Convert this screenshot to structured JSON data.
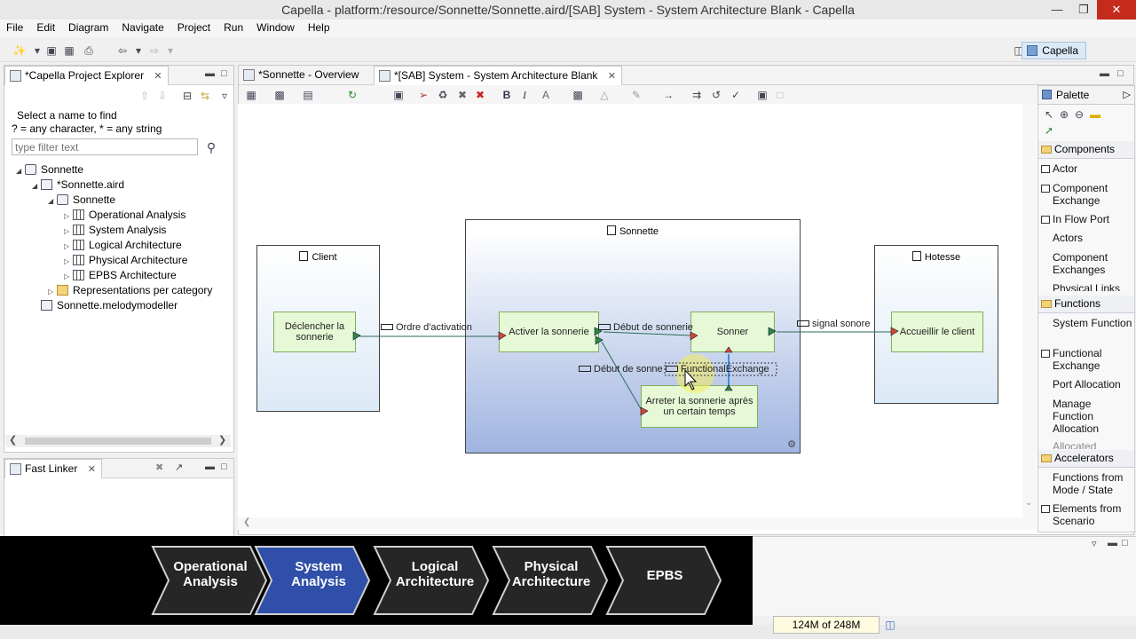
{
  "window": {
    "title": "Capella - platform:/resource/Sonnette/Sonnette.aird/[SAB] System - System Architecture Blank - Capella"
  },
  "menu": [
    "File",
    "Edit",
    "Diagram",
    "Navigate",
    "Project",
    "Run",
    "Window",
    "Help"
  ],
  "perspective": {
    "label": "Capella"
  },
  "explorer": {
    "tab_label": "*Capella Project Explorer",
    "filter_hint1": "Select a name to find",
    "filter_hint2": "? = any character, * = any string",
    "filter_placeholder": "type filter text",
    "tree": [
      {
        "label": "Sonnette"
      },
      {
        "label": "*Sonnette.aird"
      },
      {
        "label": "Sonnette"
      },
      {
        "label": "Operational Analysis"
      },
      {
        "label": "System Analysis"
      },
      {
        "label": "Logical Architecture"
      },
      {
        "label": "Physical Architecture"
      },
      {
        "label": "EPBS Architecture"
      },
      {
        "label": "Representations per category"
      },
      {
        "label": "Sonnette.melodymodeller"
      }
    ]
  },
  "fast_linker": {
    "tab_label": "Fast Linker"
  },
  "editor": {
    "tabs": [
      {
        "label": "*Sonnette - Overview"
      },
      {
        "label": "*[SAB] System - System Architecture Blank"
      }
    ]
  },
  "diagram": {
    "actors": [
      {
        "name": "Client"
      },
      {
        "name": "Hotesse"
      }
    ],
    "system": {
      "name": "Sonnette"
    },
    "functions": [
      {
        "name": "Déclencher la sonnerie"
      },
      {
        "name": "Activer la sonnerie"
      },
      {
        "name": "Sonner"
      },
      {
        "name": "Arreter la sonnerie après un certain temps"
      },
      {
        "name": "Accueillir le client"
      }
    ],
    "exchanges": [
      {
        "label": "Ordre d'activation"
      },
      {
        "label": "Début de sonnerie"
      },
      {
        "label": "Début de sonne"
      },
      {
        "label": "FunctionalExchange"
      },
      {
        "label": "signal sonore"
      }
    ]
  },
  "palette": {
    "title": "Palette",
    "sections": [
      {
        "label": "Components",
        "items": [
          "Actor",
          "Component Exchange",
          "In Flow Port",
          "Actors",
          "Component Exchanges",
          "Physical Links"
        ]
      },
      {
        "label": "Functions",
        "items": [
          "System Function",
          "Functional Exchange",
          "Port Allocation",
          "Manage Function Allocation",
          "Allocated"
        ]
      },
      {
        "label": "Accelerators",
        "items": [
          "Functions from Mode / State",
          "Elements from Scenario"
        ]
      }
    ]
  },
  "lifecycle_banner": {
    "steps": [
      {
        "label": "Operational Analysis",
        "active": false
      },
      {
        "label": "System Analysis",
        "active": true
      },
      {
        "label": "Logical Architecture",
        "active": false
      },
      {
        "label": "Physical Architecture",
        "active": false
      },
      {
        "label": "EPBS",
        "active": false
      }
    ]
  },
  "status": {
    "memory": "124M of 248M"
  },
  "colors": {
    "function_fill": "#e6f8d6",
    "system_fill": "#9fb4e0",
    "actor_fill": "#dce9f6",
    "active_step": "#2f4fa8"
  }
}
